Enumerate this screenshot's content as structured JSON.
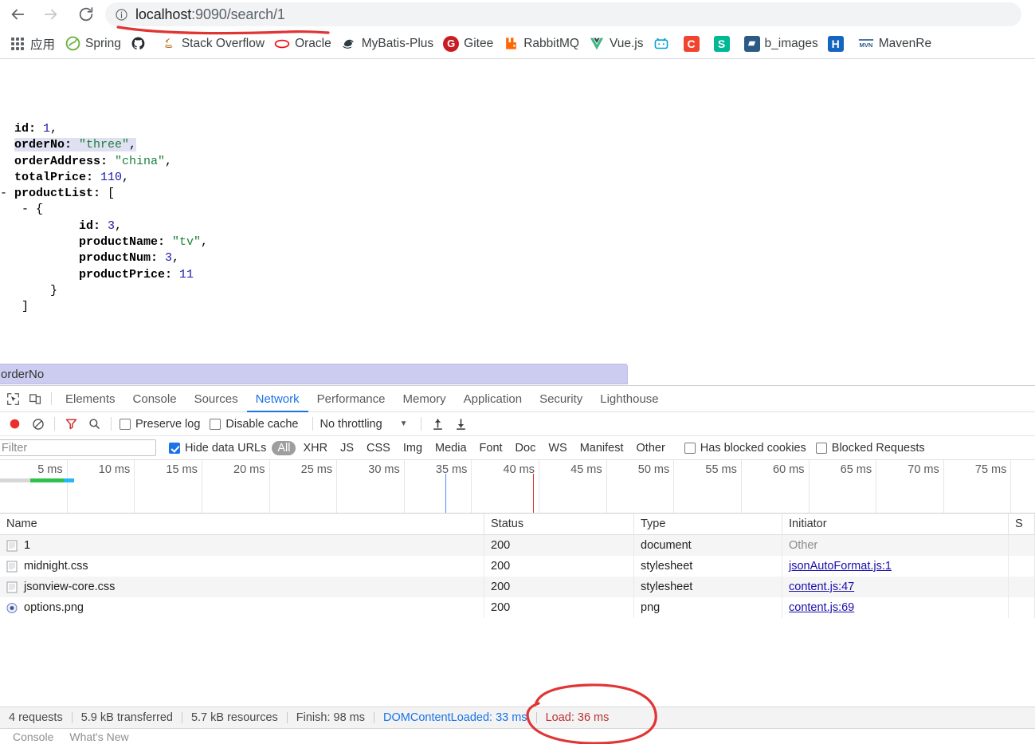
{
  "browser": {
    "back_label": "Back",
    "forward_label": "Forward",
    "reload_label": "Reload",
    "url_host": "localhost",
    "url_path": ":9090/search/1",
    "url_full": "localhost:9090/search/1",
    "site_info_icon": "info-circle-icon",
    "bookmarks": [
      {
        "label": "应用",
        "icon": "apps-grid-icon",
        "color": "#5f6368"
      },
      {
        "label": "Spring",
        "icon": "spring-leaf-icon",
        "color": "#6db33f"
      },
      {
        "label": "",
        "icon": "github-icon",
        "color": "#24292e"
      },
      {
        "label": "Stack Overflow",
        "icon": "java-duke-icon",
        "color": "#b07219"
      },
      {
        "label": "Oracle",
        "icon": "oracle-icon",
        "color": "#f80000"
      },
      {
        "label": "MyBatis-Plus",
        "icon": "mybatis-bird-icon",
        "color": "#2d3b45"
      },
      {
        "label": "Gitee",
        "icon": "gitee-icon",
        "color": "#c71d23"
      },
      {
        "label": "RabbitMQ",
        "icon": "rabbitmq-icon",
        "color": "#ff6600"
      },
      {
        "label": "Vue.js",
        "icon": "vuejs-icon",
        "color": "#41b883"
      },
      {
        "label": "",
        "icon": "bilibili-icon",
        "color": "#00a1d6"
      },
      {
        "label": "",
        "icon": "c-letter-icon",
        "color": "#f0442e"
      },
      {
        "label": "",
        "icon": "s-letter-icon",
        "color": "#00b894"
      },
      {
        "label": "b_images",
        "icon": "blue-doc-icon",
        "color": "#2b5a87"
      },
      {
        "label": "",
        "icon": "h-letter-icon",
        "color": "#1565c0"
      },
      {
        "label": "MavenRe",
        "icon": "maven-icon",
        "color": "#2b5a87"
      }
    ]
  },
  "json_viewer": {
    "lines": [
      {
        "indent": 2,
        "marker": "",
        "key": "id",
        "colon": ": ",
        "value": "1",
        "vtype": "num",
        "comma": ",",
        "highlight": false
      },
      {
        "indent": 2,
        "marker": "",
        "key": "orderNo",
        "colon": ": ",
        "value": "three",
        "vtype": "str",
        "comma": ",",
        "highlight": true
      },
      {
        "indent": 2,
        "marker": "",
        "key": "orderAddress",
        "colon": ": ",
        "value": "china",
        "vtype": "str",
        "comma": ",",
        "highlight": false
      },
      {
        "indent": 2,
        "marker": "",
        "key": "totalPrice",
        "colon": ": ",
        "value": "110",
        "vtype": "num",
        "comma": ",",
        "highlight": false
      },
      {
        "indent": 2,
        "marker": "-",
        "key": "productList",
        "colon": ": ",
        "value": "[",
        "vtype": "punct",
        "comma": "",
        "highlight": false
      },
      {
        "indent": 5,
        "marker": "-",
        "key": "",
        "colon": "",
        "value": "{",
        "vtype": "punct",
        "comma": "",
        "highlight": false
      },
      {
        "indent": 11,
        "marker": "",
        "key": "id",
        "colon": ": ",
        "value": "3",
        "vtype": "num",
        "comma": ",",
        "highlight": false
      },
      {
        "indent": 11,
        "marker": "",
        "key": "productName",
        "colon": ": ",
        "value": "tv",
        "vtype": "str",
        "comma": ",",
        "highlight": false
      },
      {
        "indent": 11,
        "marker": "",
        "key": "productNum",
        "colon": ": ",
        "value": "3",
        "vtype": "num",
        "comma": ",",
        "highlight": false
      },
      {
        "indent": 11,
        "marker": "",
        "key": "productPrice",
        "colon": ": ",
        "value": "11",
        "vtype": "num",
        "comma": "",
        "highlight": false
      },
      {
        "indent": 7,
        "marker": "",
        "key": "",
        "colon": "",
        "value": "}",
        "vtype": "punct",
        "comma": "",
        "highlight": false
      },
      {
        "indent": 3,
        "marker": "",
        "key": "",
        "colon": "",
        "value": "]",
        "vtype": "punct",
        "comma": "",
        "highlight": false
      }
    ]
  },
  "find_highlight": {
    "text": "orderNo",
    "color": "#ccccf0"
  },
  "devtools": {
    "icons": {
      "inspect": "inspect-element-icon",
      "device": "device-toolbar-icon",
      "record": "record-circle-icon",
      "clear": "clear-no-entry-icon",
      "filter": "filter-funnel-icon",
      "search": "search-magnifier-icon",
      "import": "import-arrow-up-icon",
      "export": "export-arrow-down-icon"
    },
    "tabs": [
      {
        "label": "Elements",
        "active": false
      },
      {
        "label": "Console",
        "active": false
      },
      {
        "label": "Sources",
        "active": false
      },
      {
        "label": "Network",
        "active": true
      },
      {
        "label": "Performance",
        "active": false
      },
      {
        "label": "Memory",
        "active": false
      },
      {
        "label": "Application",
        "active": false
      },
      {
        "label": "Security",
        "active": false
      },
      {
        "label": "Lighthouse",
        "active": false
      }
    ],
    "toolbar": {
      "preserve_log_label": "Preserve log",
      "preserve_log_checked": false,
      "disable_cache_label": "Disable cache",
      "disable_cache_checked": false,
      "throttling_value": "No throttling",
      "record_active_color": "#e8302f",
      "filter_active_color": "#d32f2f"
    },
    "filterbar": {
      "filter_placeholder": "Filter",
      "filter_value": "",
      "hide_data_urls_label": "Hide data URLs",
      "hide_data_urls_checked": true,
      "types": [
        {
          "label": "All",
          "selected": true
        },
        {
          "label": "XHR",
          "selected": false
        },
        {
          "label": "JS",
          "selected": false
        },
        {
          "label": "CSS",
          "selected": false
        },
        {
          "label": "Img",
          "selected": false
        },
        {
          "label": "Media",
          "selected": false
        },
        {
          "label": "Font",
          "selected": false
        },
        {
          "label": "Doc",
          "selected": false
        },
        {
          "label": "WS",
          "selected": false
        },
        {
          "label": "Manifest",
          "selected": false
        },
        {
          "label": "Other",
          "selected": false
        }
      ],
      "has_blocked_cookies_label": "Has blocked cookies",
      "has_blocked_cookies_checked": false,
      "blocked_requests_label": "Blocked Requests",
      "blocked_requests_checked": false
    },
    "overview": {
      "ticks": [
        "5 ms",
        "10 ms",
        "15 ms",
        "20 ms",
        "25 ms",
        "30 ms",
        "35 ms",
        "40 ms",
        "45 ms",
        "50 ms",
        "55 ms",
        "60 ms",
        "65 ms",
        "70 ms",
        "75 ms"
      ],
      "dcl_marker_ms": 33,
      "load_marker_ms": 36,
      "dcl_color": "#4a8df8",
      "load_color": "#e03030",
      "bar_segments": [
        {
          "color": "#d7d7d7",
          "width": 38
        },
        {
          "color": "#2ec14e",
          "width": 42
        },
        {
          "color": "#29b6f6",
          "width": 13
        }
      ]
    },
    "table": {
      "columns": [
        "Name",
        "Status",
        "Type",
        "Initiator",
        "S"
      ],
      "rows": [
        {
          "name": "1",
          "icon": "document-file-icon",
          "status": "200",
          "type": "document",
          "initiator": "Other",
          "initiator_link": false
        },
        {
          "name": "midnight.css",
          "icon": "stylesheet-file-icon",
          "status": "200",
          "type": "stylesheet",
          "initiator": "jsonAutoFormat.js:1",
          "initiator_link": true
        },
        {
          "name": "jsonview-core.css",
          "icon": "stylesheet-file-icon",
          "status": "200",
          "type": "stylesheet",
          "initiator": "content.js:47",
          "initiator_link": true
        },
        {
          "name": "options.png",
          "icon": "image-file-icon",
          "status": "200",
          "type": "png",
          "initiator": "content.js:69",
          "initiator_link": true
        }
      ]
    },
    "status_bar": {
      "requests": "4 requests",
      "transferred": "5.9 kB transferred",
      "resources": "5.7 kB resources",
      "finish": "Finish: 98 ms",
      "dom_content_loaded": "DOMContentLoaded: 33 ms",
      "load": "Load: 36 ms"
    },
    "drawer_tabs": [
      "Console",
      "What's New"
    ]
  },
  "annotations": {
    "color": "#e03535",
    "url_underline": "red-underline-under-url",
    "load_circle": "red-ellipse-around-load-time"
  }
}
